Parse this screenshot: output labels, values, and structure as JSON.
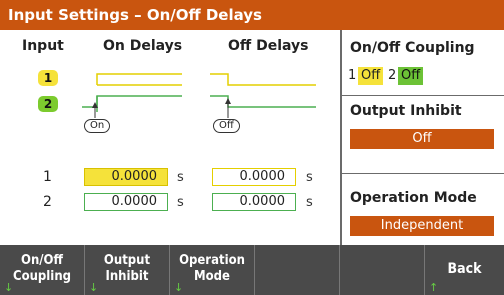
{
  "title": "Input Settings – On/Off Delays",
  "headers": {
    "input": "Input",
    "on_delays": "On Delays",
    "off_delays": "Off Delays"
  },
  "inputs": [
    "1",
    "2"
  ],
  "badge_colors": {
    "input1": "#f5e23a",
    "input2": "#7ccb2e"
  },
  "tags": {
    "on": "On",
    "off": "Off"
  },
  "rows": [
    {
      "label": "1",
      "on": "0.0000",
      "on_unit": "s",
      "off": "0.0000",
      "off_unit": "s"
    },
    {
      "label": "2",
      "on": "0.0000",
      "on_unit": "s",
      "off": "0.0000",
      "off_unit": "s"
    }
  ],
  "coupling": {
    "header": "On/Off Coupling",
    "ch1_label": "1",
    "ch1_value": "Off",
    "ch2_label": "2",
    "ch2_value": "Off"
  },
  "output_inhibit": {
    "header": "Output Inhibit",
    "value": "Off"
  },
  "operation_mode": {
    "header": "Operation Mode",
    "value": "Independent"
  },
  "softkeys": [
    {
      "line1": "On/Off",
      "line2": "Coupling"
    },
    {
      "line1": "Output",
      "line2": "Inhibit"
    },
    {
      "line1": "Operation",
      "line2": "Mode"
    },
    {
      "line1": "",
      "line2": ""
    },
    {
      "line1": "",
      "line2": ""
    },
    {
      "line1": "Back",
      "line2": ""
    }
  ],
  "accent_color": "#c9550f"
}
